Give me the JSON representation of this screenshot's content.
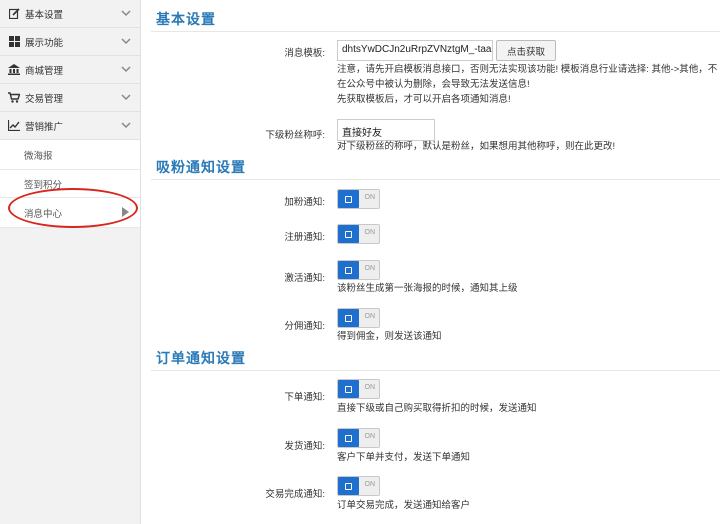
{
  "sidebar": {
    "items": [
      {
        "label": "基本设置",
        "icon": "edit-icon"
      },
      {
        "label": "展示功能",
        "icon": "windows-icon"
      },
      {
        "label": "商城管理",
        "icon": "bank-icon"
      },
      {
        "label": "交易管理",
        "icon": "cart-icon"
      },
      {
        "label": "营销推广",
        "icon": "chart-icon"
      }
    ],
    "sub_items": [
      {
        "label": "微海报"
      },
      {
        "label": "签到积分"
      },
      {
        "label": "消息中心"
      }
    ]
  },
  "sections": {
    "basic": {
      "title": "基本设置",
      "template_label": "消息模板:",
      "template_value": "dhtsYwDCJn2uRrpZVNztgM_-taa",
      "get_button": "点击获取",
      "template_help": [
        "注意，请先开启模板消息接口，否则无法实现该功能! 模板消息行业请选择: 其他->其他，不",
        "在公众号中被认为删除，会导致无法发送信息!",
        "先获取模板后，才可以开启各项通知消息!"
      ],
      "alias_label": "下级粉丝称呼:",
      "alias_value": "直接好友",
      "alias_help": "对下级粉丝的称呼，默认是粉丝，如果想用其他称呼，则在此更改!"
    },
    "fans": {
      "title": "吸粉通知设置",
      "toggles": [
        {
          "label": "加粉通知:",
          "state": "ON",
          "help": ""
        },
        {
          "label": "注册通知:",
          "state": "ON",
          "help": ""
        },
        {
          "label": "激活通知:",
          "state": "ON",
          "help": "该粉丝生成第一张海报的时候，通知其上级"
        },
        {
          "label": "分佣通知:",
          "state": "ON",
          "help": "得到佣金，则发送该通知"
        }
      ]
    },
    "order": {
      "title": "订单通知设置",
      "toggles": [
        {
          "label": "下单通知:",
          "state": "ON",
          "help": "直接下级或自己购买取得折扣的时候，发送通知"
        },
        {
          "label": "发货通知:",
          "state": "ON",
          "help": "客户下单并支付，发送下单通知"
        },
        {
          "label": "交易完成通知:",
          "state": "ON",
          "help": "订单交易完成，发送通知给客户"
        }
      ]
    }
  },
  "colors": {
    "accent": "#2b7ab8",
    "toggle": "#1f6fcf",
    "highlight": "#d9261c"
  }
}
